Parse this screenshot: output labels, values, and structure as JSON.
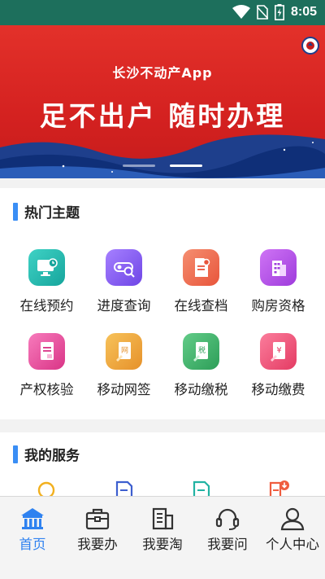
{
  "status": {
    "time": "8:05"
  },
  "banner": {
    "app_name": "长沙不动产App",
    "slogan": "足不出户 随时办理",
    "page_count": 2,
    "active_page": 2
  },
  "hot_topics": {
    "title": "热门主题",
    "items": [
      {
        "label": "在线预约",
        "icon": "monitor-clock-icon",
        "color": "#1fb5ad"
      },
      {
        "label": "进度查询",
        "icon": "progress-search-icon",
        "color": "#8c62f5"
      },
      {
        "label": "在线查档",
        "icon": "document-search-icon",
        "color": "#f06a4d"
      },
      {
        "label": "购房资格",
        "icon": "building-icon",
        "color": "#b651e6"
      },
      {
        "label": "产权核验",
        "icon": "certificate-icon",
        "color": "#e8489a"
      },
      {
        "label": "移动网签",
        "icon": "sign-contract-icon",
        "color": "#eca53a"
      },
      {
        "label": "移动缴税",
        "icon": "tax-payment-icon",
        "color": "#3fb26a"
      },
      {
        "label": "移动缴费",
        "icon": "fee-payment-icon",
        "color": "#f2537a"
      }
    ]
  },
  "my_services": {
    "title": "我的服务",
    "icons": [
      "search-circle-icon",
      "form-icon",
      "edit-document-icon",
      "download-document-icon"
    ]
  },
  "tabbar": {
    "active": 0,
    "items": [
      {
        "label": "首页",
        "icon": "home-icon"
      },
      {
        "label": "我要办",
        "icon": "briefcase-icon"
      },
      {
        "label": "我要淘",
        "icon": "buildings-icon"
      },
      {
        "label": "我要问",
        "icon": "headset-icon"
      },
      {
        "label": "个人中心",
        "icon": "person-icon"
      }
    ]
  },
  "colors": {
    "accent": "#2f82f0",
    "status_bar": "#1d6f5c",
    "banner": "#d42120"
  }
}
